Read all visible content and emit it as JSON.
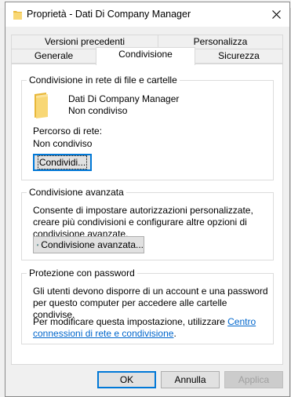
{
  "window": {
    "title": "Proprietà - Dati Di Company Manager",
    "close_symbol": "✕"
  },
  "tabs_row1": [
    {
      "label": "Versioni precedenti"
    },
    {
      "label": "Personalizza"
    }
  ],
  "tabs_row2": [
    {
      "label": "Generale"
    },
    {
      "label": "Condivisione",
      "active": true
    },
    {
      "label": "Sicurezza"
    }
  ],
  "network_sharing": {
    "group_label": "Condivisione in rete di file e cartelle",
    "folder_name": "Dati Di Company Manager",
    "folder_status": "Non condiviso",
    "path_label": "Percorso di rete:",
    "path_value": "Non condiviso",
    "share_button": "Condividi..."
  },
  "advanced_sharing": {
    "group_label": "Condivisione avanzata",
    "description": "Consente di impostare autorizzazioni personalizzate, creare più condivisioni e configurare altre opzioni di condivisione avanzate.",
    "button": "Condivisione avanzata..."
  },
  "password_protection": {
    "group_label": "Protezione con password",
    "description": "Gli utenti devono disporre di un account e una password per questo computer per accedere alle cartelle condivise.",
    "change_prefix": "Per modificare questa impostazione, utilizzare ",
    "link_text": "Centro connessioni di rete e condivisione",
    "suffix": "."
  },
  "footer": {
    "ok": "OK",
    "cancel": "Annulla",
    "apply": "Applica"
  },
  "colors": {
    "link": "#0066cc",
    "focus_border": "#0078d7",
    "folder": "#f8d775"
  }
}
